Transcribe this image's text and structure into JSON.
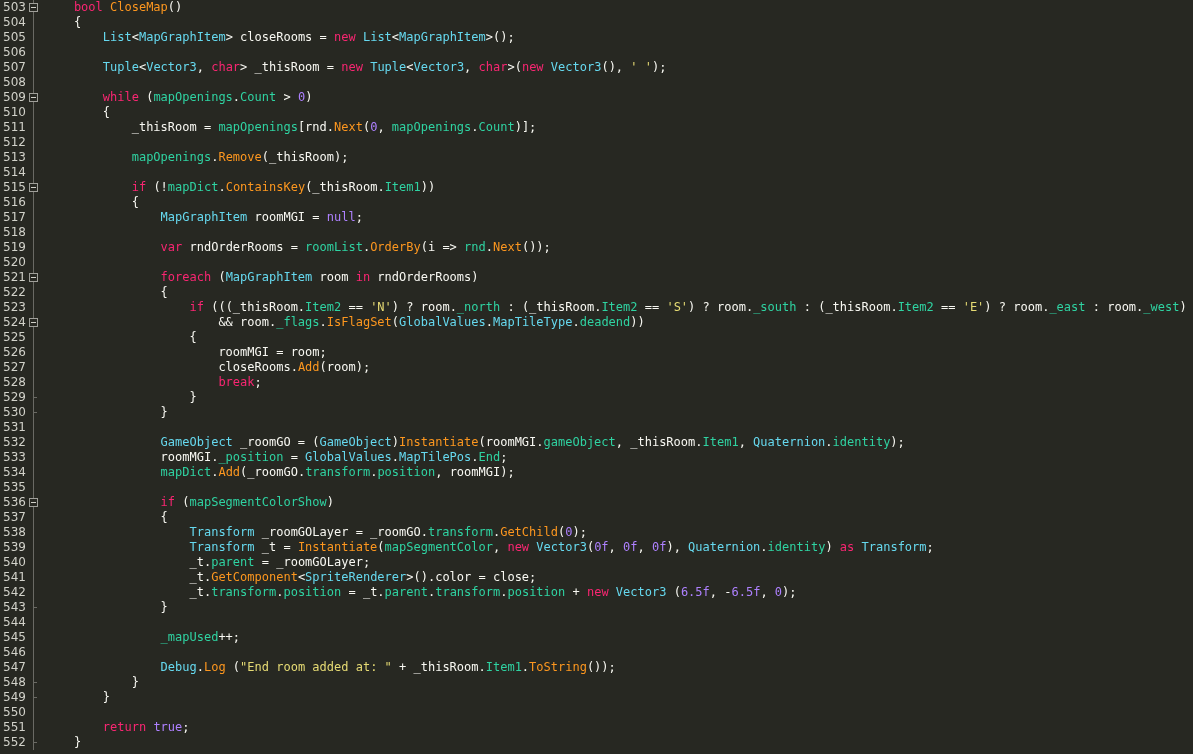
{
  "editor": {
    "lines": [
      {
        "number": "503",
        "kind": "fold_start",
        "tokens": [
          {
            "kind": "keyword",
            "text": "    bool"
          },
          {
            "kind": "method",
            "text": " CloseMap"
          },
          {
            "kind": "plain",
            "text": "()"
          }
        ]
      },
      {
        "number": "504",
        "kind": "line",
        "tokens": [
          {
            "kind": "plain",
            "text": "    {"
          }
        ]
      },
      {
        "number": "505",
        "kind": "line",
        "tokens": [
          {
            "kind": "type",
            "text": "        List"
          },
          {
            "kind": "plain",
            "text": "<"
          },
          {
            "kind": "type",
            "text": "MapGraphItem"
          },
          {
            "kind": "plain",
            "text": "> closeRooms = "
          },
          {
            "kind": "keyword",
            "text": "new"
          },
          {
            "kind": "type",
            "text": " List"
          },
          {
            "kind": "plain",
            "text": "<"
          },
          {
            "kind": "type",
            "text": "MapGraphItem"
          },
          {
            "kind": "plain",
            "text": ">();"
          }
        ]
      },
      {
        "number": "506",
        "kind": "line"
      },
      {
        "number": "507",
        "kind": "line",
        "tokens": [
          {
            "kind": "type",
            "text": "        Tuple"
          },
          {
            "kind": "plain",
            "text": "<"
          },
          {
            "kind": "type",
            "text": "Vector3"
          },
          {
            "kind": "plain",
            "text": ", "
          },
          {
            "kind": "keyword",
            "text": "char"
          },
          {
            "kind": "plain",
            "text": "> _thisRoom = "
          },
          {
            "kind": "keyword",
            "text": "new"
          },
          {
            "kind": "type",
            "text": " Tuple"
          },
          {
            "kind": "plain",
            "text": "<"
          },
          {
            "kind": "type",
            "text": "Vector3"
          },
          {
            "kind": "plain",
            "text": ", "
          },
          {
            "kind": "keyword",
            "text": "char"
          },
          {
            "kind": "plain",
            "text": ">("
          },
          {
            "kind": "keyword",
            "text": "new"
          },
          {
            "kind": "type",
            "text": " Vector3"
          },
          {
            "kind": "plain",
            "text": "(), "
          },
          {
            "kind": "string",
            "text": "' '"
          },
          {
            "kind": "plain",
            "text": ");"
          }
        ]
      },
      {
        "number": "508",
        "kind": "line"
      },
      {
        "number": "509",
        "kind": "fold_start",
        "tokens": [
          {
            "kind": "keyword",
            "text": "        while"
          },
          {
            "kind": "plain",
            "text": " ("
          },
          {
            "kind": "member",
            "text": "mapOpenings"
          },
          {
            "kind": "plain",
            "text": "."
          },
          {
            "kind": "member",
            "text": "Count"
          },
          {
            "kind": "plain",
            "text": " > "
          },
          {
            "kind": "number",
            "text": "0"
          },
          {
            "kind": "plain",
            "text": ")"
          }
        ]
      },
      {
        "number": "510",
        "kind": "line",
        "tokens": [
          {
            "kind": "plain",
            "text": "        {"
          }
        ]
      },
      {
        "number": "511",
        "kind": "line",
        "tokens": [
          {
            "kind": "plain",
            "text": "            _thisRoom = "
          },
          {
            "kind": "member",
            "text": "mapOpenings"
          },
          {
            "kind": "plain",
            "text": "[rnd."
          },
          {
            "kind": "method",
            "text": "Next"
          },
          {
            "kind": "plain",
            "text": "("
          },
          {
            "kind": "number",
            "text": "0"
          },
          {
            "kind": "plain",
            "text": ", "
          },
          {
            "kind": "member",
            "text": "mapOpenings"
          },
          {
            "kind": "plain",
            "text": "."
          },
          {
            "kind": "member",
            "text": "Count"
          },
          {
            "kind": "plain",
            "text": ")];"
          }
        ]
      },
      {
        "number": "512",
        "kind": "line"
      },
      {
        "number": "513",
        "kind": "line",
        "tokens": [
          {
            "kind": "member",
            "text": "            mapOpenings"
          },
          {
            "kind": "plain",
            "text": "."
          },
          {
            "kind": "method",
            "text": "Remove"
          },
          {
            "kind": "plain",
            "text": "(_thisRoom);"
          }
        ]
      },
      {
        "number": "514",
        "kind": "line"
      },
      {
        "number": "515",
        "kind": "fold_start",
        "tokens": [
          {
            "kind": "keyword",
            "text": "            if"
          },
          {
            "kind": "plain",
            "text": " (!"
          },
          {
            "kind": "member",
            "text": "mapDict"
          },
          {
            "kind": "plain",
            "text": "."
          },
          {
            "kind": "method",
            "text": "ContainsKey"
          },
          {
            "kind": "plain",
            "text": "(_thisRoom."
          },
          {
            "kind": "member",
            "text": "Item1"
          },
          {
            "kind": "plain",
            "text": "))"
          }
        ]
      },
      {
        "number": "516",
        "kind": "line",
        "tokens": [
          {
            "kind": "plain",
            "text": "            {"
          }
        ]
      },
      {
        "number": "517",
        "kind": "line",
        "tokens": [
          {
            "kind": "type",
            "text": "                MapGraphItem"
          },
          {
            "kind": "plain",
            "text": " roomMGI = "
          },
          {
            "kind": "number",
            "text": "null"
          },
          {
            "kind": "plain",
            "text": ";"
          }
        ]
      },
      {
        "number": "518",
        "kind": "line"
      },
      {
        "number": "519",
        "kind": "line",
        "tokens": [
          {
            "kind": "keyword",
            "text": "                var"
          },
          {
            "kind": "plain",
            "text": " rndOrderRooms = "
          },
          {
            "kind": "member",
            "text": "roomList"
          },
          {
            "kind": "plain",
            "text": "."
          },
          {
            "kind": "method",
            "text": "OrderBy"
          },
          {
            "kind": "plain",
            "text": "(i => "
          },
          {
            "kind": "member",
            "text": "rnd"
          },
          {
            "kind": "plain",
            "text": "."
          },
          {
            "kind": "method",
            "text": "Next"
          },
          {
            "kind": "plain",
            "text": "());"
          }
        ]
      },
      {
        "number": "520",
        "kind": "line"
      },
      {
        "number": "521",
        "kind": "fold_start",
        "tokens": [
          {
            "kind": "keyword",
            "text": "                foreach"
          },
          {
            "kind": "plain",
            "text": " ("
          },
          {
            "kind": "type",
            "text": "MapGraphItem"
          },
          {
            "kind": "plain",
            "text": " room "
          },
          {
            "kind": "keyword",
            "text": "in"
          },
          {
            "kind": "plain",
            "text": " rndOrderRooms)"
          }
        ]
      },
      {
        "number": "522",
        "kind": "line",
        "tokens": [
          {
            "kind": "plain",
            "text": "                {"
          }
        ]
      },
      {
        "number": "523",
        "kind": "line",
        "tokens": [
          {
            "kind": "keyword",
            "text": "                    if"
          },
          {
            "kind": "plain",
            "text": " (((_thisRoom."
          },
          {
            "kind": "member",
            "text": "Item2"
          },
          {
            "kind": "plain",
            "text": " == "
          },
          {
            "kind": "string",
            "text": "'N'"
          },
          {
            "kind": "plain",
            "text": ") ? room."
          },
          {
            "kind": "member",
            "text": "_north"
          },
          {
            "kind": "plain",
            "text": " : (_thisRoom."
          },
          {
            "kind": "member",
            "text": "Item2"
          },
          {
            "kind": "plain",
            "text": " == "
          },
          {
            "kind": "string",
            "text": "'S'"
          },
          {
            "kind": "plain",
            "text": ") ? room."
          },
          {
            "kind": "member",
            "text": "_south"
          },
          {
            "kind": "plain",
            "text": " : (_thisRoom."
          },
          {
            "kind": "member",
            "text": "Item2"
          },
          {
            "kind": "plain",
            "text": " == "
          },
          {
            "kind": "string",
            "text": "'E'"
          },
          {
            "kind": "plain",
            "text": ") ? room."
          },
          {
            "kind": "member",
            "text": "_east"
          },
          {
            "kind": "plain",
            "text": " : room."
          },
          {
            "kind": "member",
            "text": "_west"
          },
          {
            "kind": "plain",
            "text": ")"
          }
        ]
      },
      {
        "number": "524",
        "kind": "fold_start",
        "tokens": [
          {
            "kind": "plain",
            "text": "                        && room."
          },
          {
            "kind": "member",
            "text": "_flags"
          },
          {
            "kind": "plain",
            "text": "."
          },
          {
            "kind": "method",
            "text": "IsFlagSet"
          },
          {
            "kind": "plain",
            "text": "("
          },
          {
            "kind": "type",
            "text": "GlobalValues"
          },
          {
            "kind": "plain",
            "text": "."
          },
          {
            "kind": "type",
            "text": "MapTileType"
          },
          {
            "kind": "plain",
            "text": "."
          },
          {
            "kind": "member",
            "text": "deadend"
          },
          {
            "kind": "plain",
            "text": "))"
          }
        ]
      },
      {
        "number": "525",
        "kind": "line",
        "tokens": [
          {
            "kind": "plain",
            "text": "                    {"
          }
        ]
      },
      {
        "number": "526",
        "kind": "line",
        "tokens": [
          {
            "kind": "plain",
            "text": "                        roomMGI = room;"
          }
        ]
      },
      {
        "number": "527",
        "kind": "line",
        "tokens": [
          {
            "kind": "plain",
            "text": "                        closeRooms."
          },
          {
            "kind": "method",
            "text": "Add"
          },
          {
            "kind": "plain",
            "text": "(room);"
          }
        ]
      },
      {
        "number": "528",
        "kind": "line",
        "tokens": [
          {
            "kind": "keyword",
            "text": "                        break"
          },
          {
            "kind": "plain",
            "text": ";"
          }
        ]
      },
      {
        "number": "529",
        "kind": "fold_end",
        "tokens": [
          {
            "kind": "plain",
            "text": "                    }"
          }
        ]
      },
      {
        "number": "530",
        "kind": "fold_end",
        "tokens": [
          {
            "kind": "plain",
            "text": "                }"
          }
        ]
      },
      {
        "number": "531",
        "kind": "line"
      },
      {
        "number": "532",
        "kind": "line",
        "tokens": [
          {
            "kind": "type",
            "text": "                GameObject"
          },
          {
            "kind": "plain",
            "text": " _roomGO = ("
          },
          {
            "kind": "type",
            "text": "GameObject"
          },
          {
            "kind": "plain",
            "text": ")"
          },
          {
            "kind": "method",
            "text": "Instantiate"
          },
          {
            "kind": "plain",
            "text": "(roomMGI."
          },
          {
            "kind": "member",
            "text": "gameObject"
          },
          {
            "kind": "plain",
            "text": ", _thisRoom."
          },
          {
            "kind": "member",
            "text": "Item1"
          },
          {
            "kind": "plain",
            "text": ", "
          },
          {
            "kind": "type",
            "text": "Quaternion"
          },
          {
            "kind": "plain",
            "text": "."
          },
          {
            "kind": "member",
            "text": "identity"
          },
          {
            "kind": "plain",
            "text": ");"
          }
        ]
      },
      {
        "number": "533",
        "kind": "line",
        "tokens": [
          {
            "kind": "plain",
            "text": "                roomMGI."
          },
          {
            "kind": "member",
            "text": "_position"
          },
          {
            "kind": "plain",
            "text": " = "
          },
          {
            "kind": "type",
            "text": "GlobalValues"
          },
          {
            "kind": "plain",
            "text": "."
          },
          {
            "kind": "type",
            "text": "MapTilePos"
          },
          {
            "kind": "plain",
            "text": "."
          },
          {
            "kind": "member",
            "text": "End"
          },
          {
            "kind": "plain",
            "text": ";"
          }
        ]
      },
      {
        "number": "534",
        "kind": "line",
        "tokens": [
          {
            "kind": "member",
            "text": "                mapDict"
          },
          {
            "kind": "plain",
            "text": "."
          },
          {
            "kind": "method",
            "text": "Add"
          },
          {
            "kind": "plain",
            "text": "(_roomGO."
          },
          {
            "kind": "member",
            "text": "transform"
          },
          {
            "kind": "plain",
            "text": "."
          },
          {
            "kind": "member",
            "text": "position"
          },
          {
            "kind": "plain",
            "text": ", roomMGI);"
          }
        ]
      },
      {
        "number": "535",
        "kind": "line"
      },
      {
        "number": "536",
        "kind": "fold_start",
        "tokens": [
          {
            "kind": "keyword",
            "text": "                if"
          },
          {
            "kind": "plain",
            "text": " ("
          },
          {
            "kind": "member",
            "text": "mapSegmentColorShow"
          },
          {
            "kind": "plain",
            "text": ")"
          }
        ]
      },
      {
        "number": "537",
        "kind": "line",
        "tokens": [
          {
            "kind": "plain",
            "text": "                {"
          }
        ]
      },
      {
        "number": "538",
        "kind": "line",
        "tokens": [
          {
            "kind": "type",
            "text": "                    Transform"
          },
          {
            "kind": "plain",
            "text": " _roomGOLayer = _roomGO."
          },
          {
            "kind": "member",
            "text": "transform"
          },
          {
            "kind": "plain",
            "text": "."
          },
          {
            "kind": "method",
            "text": "GetChild"
          },
          {
            "kind": "plain",
            "text": "("
          },
          {
            "kind": "number",
            "text": "0"
          },
          {
            "kind": "plain",
            "text": ");"
          }
        ]
      },
      {
        "number": "539",
        "kind": "line",
        "tokens": [
          {
            "kind": "type",
            "text": "                    Transform"
          },
          {
            "kind": "plain",
            "text": " _t = "
          },
          {
            "kind": "method",
            "text": "Instantiate"
          },
          {
            "kind": "plain",
            "text": "("
          },
          {
            "kind": "member",
            "text": "mapSegmentColor"
          },
          {
            "kind": "plain",
            "text": ", "
          },
          {
            "kind": "keyword",
            "text": "new"
          },
          {
            "kind": "type",
            "text": " Vector3"
          },
          {
            "kind": "plain",
            "text": "("
          },
          {
            "kind": "number",
            "text": "0f"
          },
          {
            "kind": "plain",
            "text": ", "
          },
          {
            "kind": "number",
            "text": "0f"
          },
          {
            "kind": "plain",
            "text": ", "
          },
          {
            "kind": "number",
            "text": "0f"
          },
          {
            "kind": "plain",
            "text": "), "
          },
          {
            "kind": "type",
            "text": "Quaternion"
          },
          {
            "kind": "plain",
            "text": "."
          },
          {
            "kind": "member",
            "text": "identity"
          },
          {
            "kind": "plain",
            "text": ") "
          },
          {
            "kind": "keyword",
            "text": "as"
          },
          {
            "kind": "type",
            "text": " Transform"
          },
          {
            "kind": "plain",
            "text": ";"
          }
        ]
      },
      {
        "number": "540",
        "kind": "line",
        "tokens": [
          {
            "kind": "plain",
            "text": "                    _t."
          },
          {
            "kind": "member",
            "text": "parent"
          },
          {
            "kind": "plain",
            "text": " = _roomGOLayer;"
          }
        ]
      },
      {
        "number": "541",
        "kind": "line",
        "tokens": [
          {
            "kind": "plain",
            "text": "                    _t."
          },
          {
            "kind": "method",
            "text": "GetComponent"
          },
          {
            "kind": "plain",
            "text": "<"
          },
          {
            "kind": "type",
            "text": "SpriteRenderer"
          },
          {
            "kind": "plain",
            "text": ">().color = close;"
          }
        ]
      },
      {
        "number": "542",
        "kind": "line",
        "tokens": [
          {
            "kind": "plain",
            "text": "                    _t."
          },
          {
            "kind": "member",
            "text": "transform"
          },
          {
            "kind": "plain",
            "text": "."
          },
          {
            "kind": "member",
            "text": "position"
          },
          {
            "kind": "plain",
            "text": " = _t."
          },
          {
            "kind": "member",
            "text": "parent"
          },
          {
            "kind": "plain",
            "text": "."
          },
          {
            "kind": "member",
            "text": "transform"
          },
          {
            "kind": "plain",
            "text": "."
          },
          {
            "kind": "member",
            "text": "position"
          },
          {
            "kind": "plain",
            "text": " + "
          },
          {
            "kind": "keyword",
            "text": "new"
          },
          {
            "kind": "type",
            "text": " Vector3"
          },
          {
            "kind": "plain",
            "text": " ("
          },
          {
            "kind": "number",
            "text": "6.5f"
          },
          {
            "kind": "plain",
            "text": ", -"
          },
          {
            "kind": "number",
            "text": "6.5f"
          },
          {
            "kind": "plain",
            "text": ", "
          },
          {
            "kind": "number",
            "text": "0"
          },
          {
            "kind": "plain",
            "text": ");"
          }
        ]
      },
      {
        "number": "543",
        "kind": "fold_end",
        "tokens": [
          {
            "kind": "plain",
            "text": "                }"
          }
        ]
      },
      {
        "number": "544",
        "kind": "line"
      },
      {
        "number": "545",
        "kind": "line",
        "tokens": [
          {
            "kind": "member",
            "text": "                _mapUsed"
          },
          {
            "kind": "plain",
            "text": "++;"
          }
        ]
      },
      {
        "number": "546",
        "kind": "line"
      },
      {
        "number": "547",
        "kind": "line",
        "tokens": [
          {
            "kind": "type",
            "text": "                Debug"
          },
          {
            "kind": "plain",
            "text": "."
          },
          {
            "kind": "method",
            "text": "Log"
          },
          {
            "kind": "plain",
            "text": " ("
          },
          {
            "kind": "string",
            "text": "\"End room added at: \""
          },
          {
            "kind": "plain",
            "text": " + _thisRoom."
          },
          {
            "kind": "member",
            "text": "Item1"
          },
          {
            "kind": "plain",
            "text": "."
          },
          {
            "kind": "method",
            "text": "ToString"
          },
          {
            "kind": "plain",
            "text": "());"
          }
        ]
      },
      {
        "number": "548",
        "kind": "fold_end",
        "tokens": [
          {
            "kind": "plain",
            "text": "            }"
          }
        ]
      },
      {
        "number": "549",
        "kind": "fold_end",
        "tokens": [
          {
            "kind": "plain",
            "text": "        }"
          }
        ]
      },
      {
        "number": "550",
        "kind": "line"
      },
      {
        "number": "551",
        "kind": "line",
        "tokens": [
          {
            "kind": "keyword",
            "text": "        return"
          },
          {
            "kind": "number",
            "text": " true"
          },
          {
            "kind": "plain",
            "text": ";"
          }
        ]
      },
      {
        "number": "552",
        "kind": "fold_end",
        "tokens": [
          {
            "kind": "plain",
            "text": "    }"
          }
        ]
      }
    ]
  }
}
